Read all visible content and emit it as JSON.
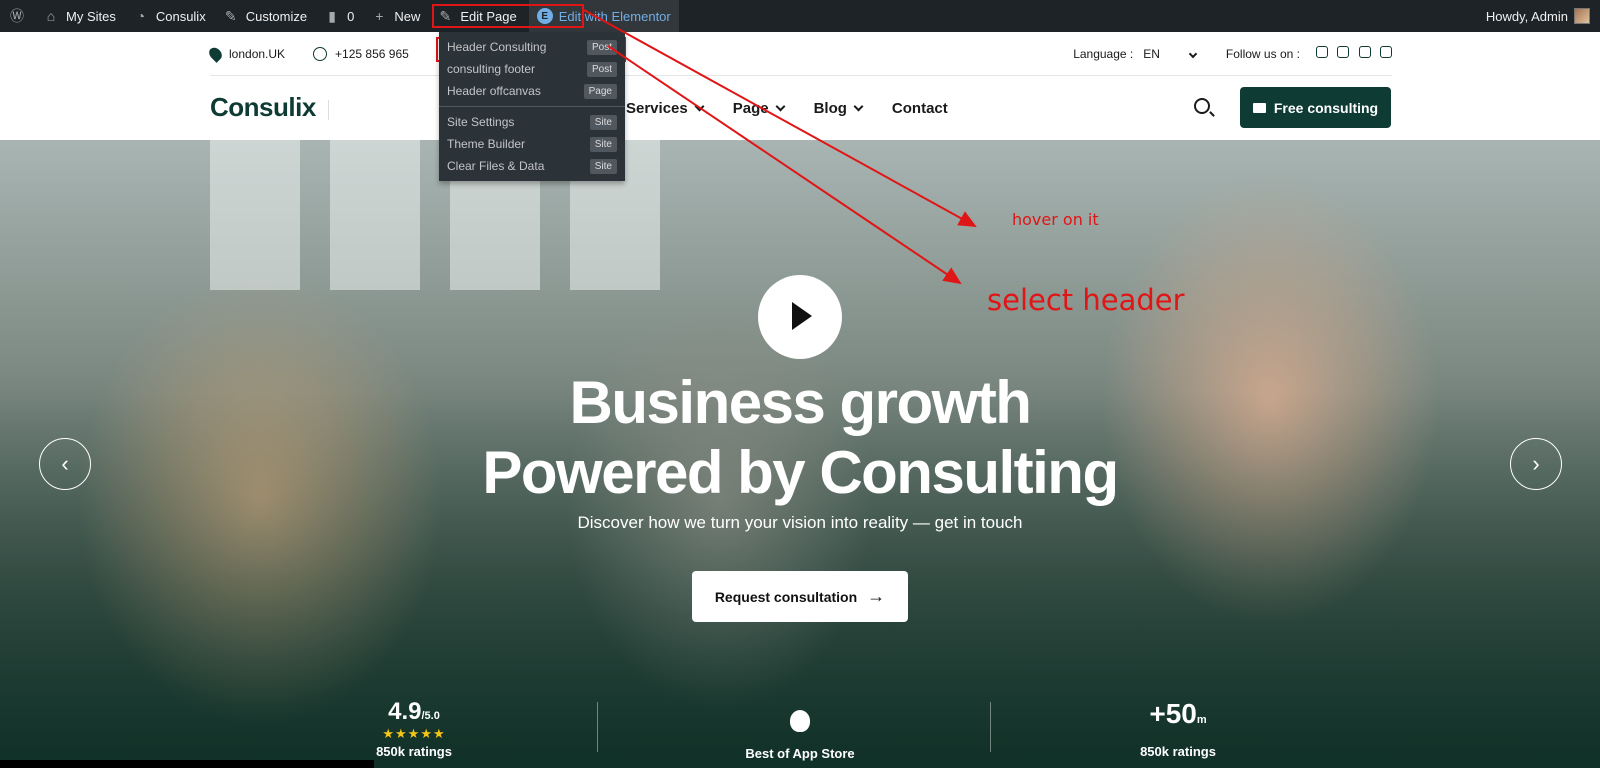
{
  "admin_bar": {
    "my_sites": "My Sites",
    "site": "Consulix",
    "customize": "Customize",
    "comments": "0",
    "new": "New",
    "edit_page": "Edit Page",
    "edit_elementor": "Edit with Elementor",
    "howdy": "Howdy, Admin"
  },
  "elementor_menu": [
    {
      "label": "Header Consulting",
      "badge": "Post"
    },
    {
      "label": "consulting footer",
      "badge": "Post"
    },
    {
      "label": "Header offcanvas",
      "badge": "Page"
    },
    {
      "label": "Site Settings",
      "badge": "Site"
    },
    {
      "label": "Theme Builder",
      "badge": "Site"
    },
    {
      "label": "Clear Files & Data",
      "badge": "Site"
    }
  ],
  "topbar": {
    "location": "london.UK",
    "phone": "+125 856 965",
    "language_label": "Language :",
    "language_value": "EN",
    "follow": "Follow us on :"
  },
  "nav": {
    "logo": "Consulix",
    "items": [
      "Services",
      "Page",
      "Blog",
      "Contact"
    ],
    "cta": "Free consulting"
  },
  "hero": {
    "title_line1": "Business growth",
    "title_line2": "Powered by Consulting",
    "subtitle": "Discover how we turn your vision into reality — get in touch",
    "button": "Request consultation",
    "stat1_value": "4.9",
    "stat1_suffix": "/5.0",
    "stat1_label": "850k ratings",
    "stat2_label": "Best of App Store",
    "stat3_value": "+50",
    "stat3_suffix": "m",
    "stat3_label": "850k ratings",
    "stars": "★★★★★"
  },
  "annotations": {
    "hover": "hover on it",
    "select": "select header"
  },
  "colors": {
    "brand": "#0e3b33",
    "annotation": "#e01515",
    "adminbar": "#1d2327"
  }
}
